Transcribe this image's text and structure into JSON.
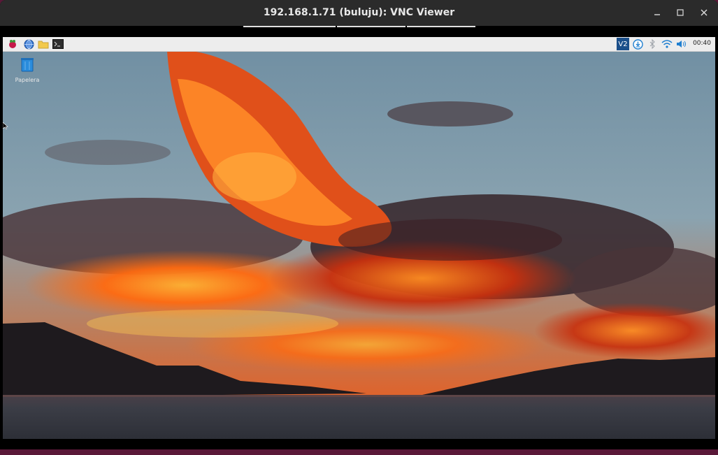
{
  "window": {
    "title": "192.168.1.71 (buluju): VNC Viewer",
    "controls": {
      "minimize": "minimize-icon",
      "maximize": "maximize-icon",
      "close": "close-icon"
    }
  },
  "panel": {
    "launchers": [
      "raspberry-menu-icon",
      "web-browser-icon",
      "file-manager-icon",
      "terminal-icon"
    ],
    "tray": [
      "vnc-server-icon",
      "update-icon",
      "bluetooth-icon",
      "wifi-icon",
      "volume-icon"
    ],
    "vnc_label": "V2",
    "clock": "00:40"
  },
  "desktop": {
    "icons": [
      {
        "label": "Papelera",
        "icon": "trash-icon"
      }
    ],
    "wallpaper": "sunset over lake with orange clouds"
  },
  "colors": {
    "titlebar": "#2b2b2b",
    "panel": "#ededed",
    "accent_blue": "#1f7fd0",
    "sky": "#7d9bab",
    "cloud_orange": "#ff7a18",
    "water": "#3a3b44"
  }
}
